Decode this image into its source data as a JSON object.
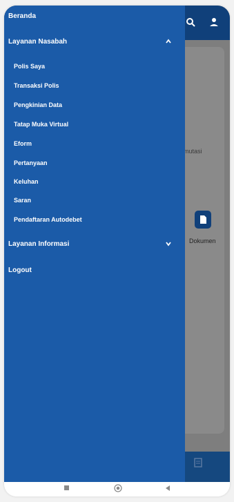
{
  "background_app": {
    "partial_label": "mutasi",
    "dokumen_label": "Dokumen"
  },
  "drawer": {
    "beranda": "Beranda",
    "layanan_nasabah": {
      "label": "Layanan Nasabah",
      "items": [
        "Polis Saya",
        "Transaksi Polis",
        "Pengkinian Data",
        "Tatap Muka Virtual",
        "Eform",
        "Pertanyaan",
        "Keluhan",
        "Saran",
        "Pendaftaran Autodebet"
      ]
    },
    "layanan_informasi": {
      "label": "Layanan Informasi"
    },
    "logout": "Logout"
  },
  "colors": {
    "drawer_bg": "#1b5ba8",
    "header_bg": "#10407a",
    "scrim": "#7e7e7e"
  },
  "icons": {
    "expand_open": "chevron-up-icon",
    "expand_closed": "chevron-down-icon",
    "header_right": "user-icon",
    "nav_recent": "square-icon",
    "nav_home": "circle-icon",
    "nav_back": "triangle-back-icon"
  }
}
